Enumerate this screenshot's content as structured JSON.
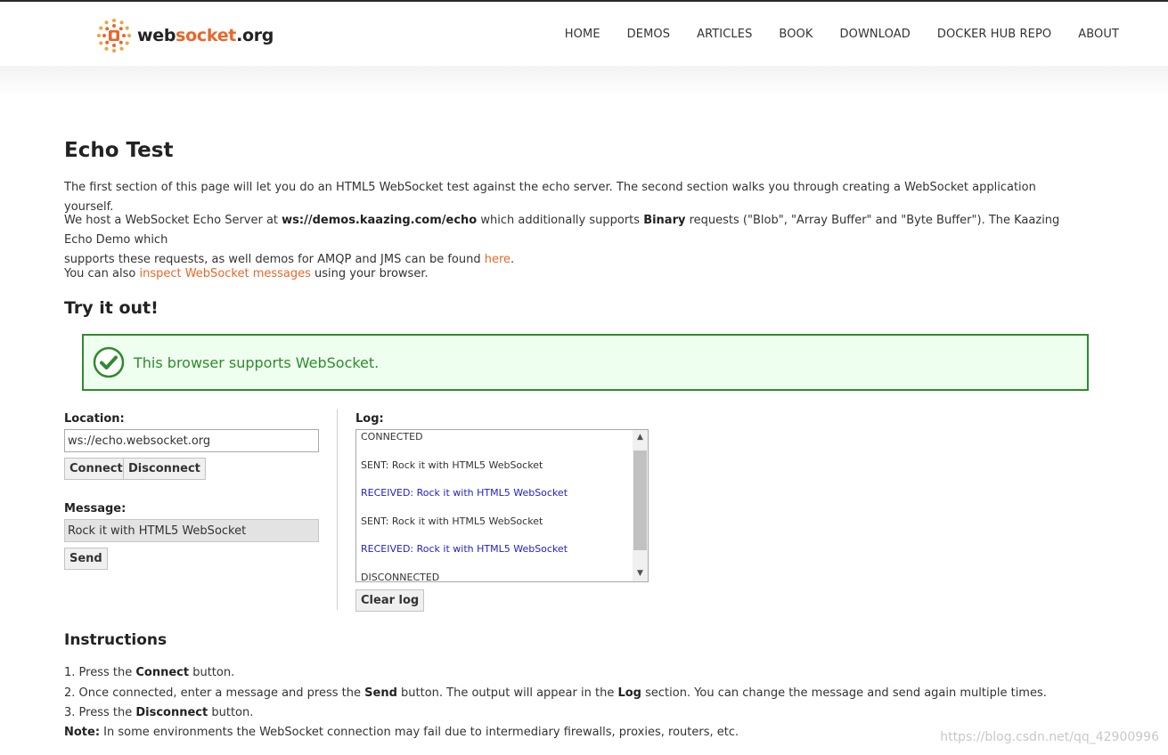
{
  "header": {
    "logo_text_1": "web",
    "logo_text_2": "socket",
    "logo_text_3": ".org",
    "nav": [
      "HOME",
      "DEMOS",
      "ARTICLES",
      "BOOK",
      "DOWNLOAD",
      "DOCKER HUB REPO",
      "ABOUT"
    ]
  },
  "main": {
    "title": "Echo Test",
    "intro": "The first section of this page will let you do an HTML5 WebSocket test against the echo server. The second section walks you through creating a WebSocket application yourself.",
    "host_1": "We host a WebSocket Echo Server at ",
    "host_server": "ws://demos.kaazing.com/echo",
    "host_2": " which additionally supports ",
    "host_binary": "Binary",
    "host_3": " requests (\"Blob\", \"Array Buffer\" and \"Byte Buffer\"). The Kaazing Echo Demo which",
    "host_4": "supports these requests, as well demos for AMQP and JMS can be found ",
    "host_link": "here",
    "host_5": ".",
    "inspect_1": "You can also ",
    "inspect_link": "inspect WebSocket messages",
    "inspect_2": " using your browser.",
    "try_title": "Try it out!",
    "support_message": "This browser supports WebSocket."
  },
  "form": {
    "location_label": "Location:",
    "location_value": "ws://echo.websocket.org",
    "connect_label": "Connect",
    "disconnect_label": "Disconnect",
    "message_label": "Message:",
    "message_value": "Rock it with HTML5 WebSocket",
    "send_label": "Send",
    "log_label": "Log:",
    "clear_log_label": "Clear log"
  },
  "log": {
    "entries": [
      {
        "text": "CONNECTED",
        "kind": "sent"
      },
      {
        "text": "SENT: Rock it with HTML5 WebSocket",
        "kind": "sent"
      },
      {
        "text": "RECEIVED: Rock it with HTML5 WebSocket",
        "kind": "recv"
      },
      {
        "text": "SENT: Rock it with HTML5 WebSocket",
        "kind": "sent"
      },
      {
        "text": "RECEIVED: Rock it with HTML5 WebSocket",
        "kind": "recv"
      },
      {
        "text": "DISCONNECTED",
        "kind": "sent"
      }
    ]
  },
  "instructions": {
    "title": "Instructions",
    "step1_a": "1.  Press the ",
    "step1_b": "Connect",
    "step1_c": " button.",
    "step2_a": "2.  Once connected, enter a message and press the ",
    "step2_b": "Send",
    "step2_c": " button. The output will appear in the ",
    "step2_d": "Log",
    "step2_e": " section. You can change the message and send again multiple times.",
    "step3_a": "3.  Press the ",
    "step3_b": "Disconnect",
    "step3_c": " button.",
    "note_label": "Note:",
    "note_text": " In some environments the WebSocket connection may fail due to intermediary firewalls, proxies, routers, etc."
  },
  "watermark": "https://blog.csdn.net/qq_42900996",
  "colors": {
    "accent": "#e8672a",
    "success": "#2e8b2e",
    "received": "#2222cc"
  }
}
